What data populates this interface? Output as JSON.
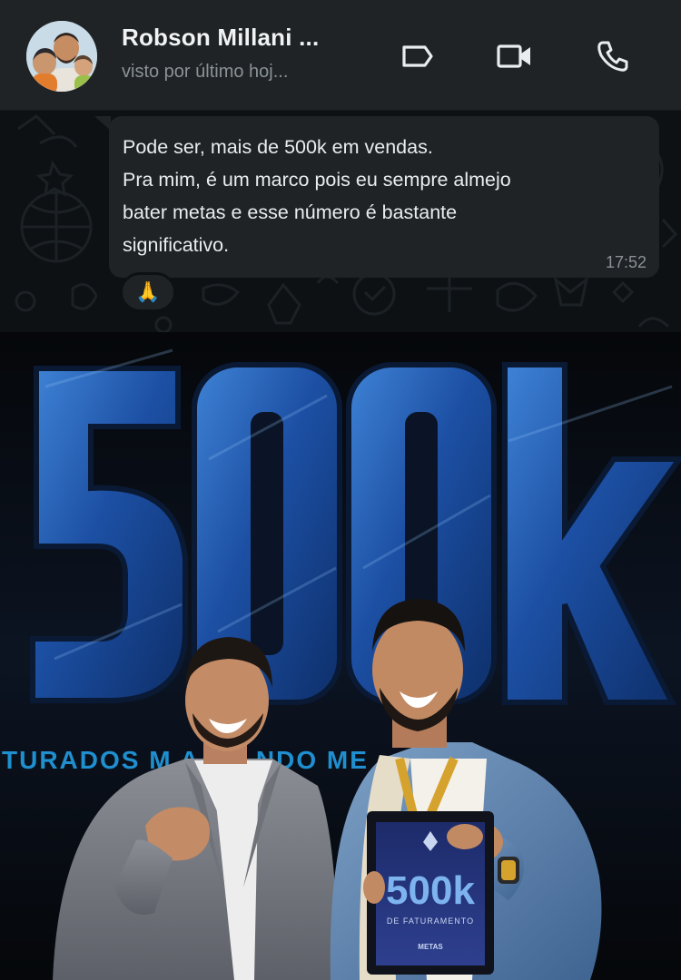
{
  "header": {
    "contact_name": "Robson Millani ...",
    "status": "visto por último hoj...",
    "icons": [
      "avatar",
      "label-icon",
      "video-call-icon",
      "phone-call-icon"
    ]
  },
  "message": {
    "text": "Pode ser, mais de 500k em vendas.\nPra mim, é um marco pois eu sempre almejo\nbater metas e esse número é bastante\nsignificativo.",
    "time": "17:52",
    "reaction": "🙏"
  },
  "photo": {
    "stage_title": "500k",
    "stage_subtitle": "TURADOS      M A DE     NDO ME",
    "plaque_title": "500k",
    "plaque_caption": "DE FATURAMENTO",
    "plaque_brand": "METAS"
  },
  "colors": {
    "header_bg": "#1f2325",
    "chat_bg": "#0d1113",
    "bubble_bg": "#1f2325",
    "text_primary": "#e9edef",
    "text_secondary": "#8a9296",
    "stage_blue": "#1f55a8"
  }
}
